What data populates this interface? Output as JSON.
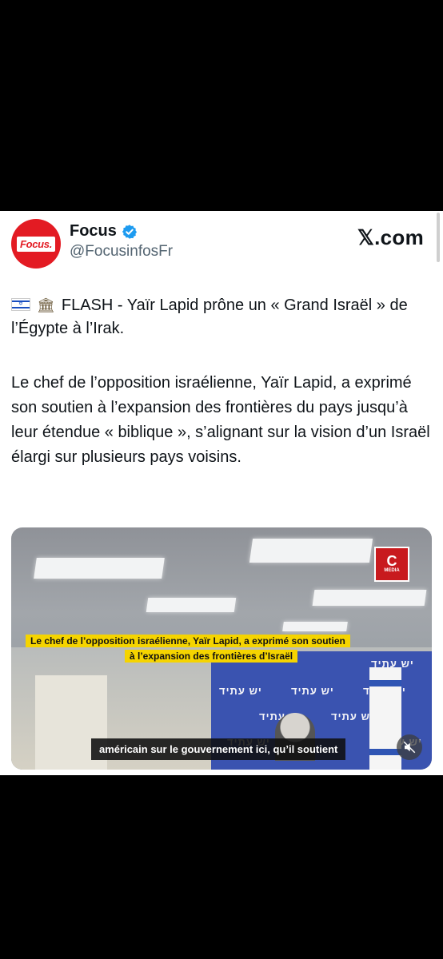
{
  "author": {
    "avatar_text": "Focus.",
    "name": "Focus",
    "handle": "@FocusinfosFr"
  },
  "brand": "𝕏.com",
  "icons": {
    "flag": "israel-flag-icon",
    "building": "classical-building-icon",
    "verified": "verified-badge-icon",
    "mute": "muted-speaker-icon"
  },
  "post": {
    "headline": "FLASH - Yaïr Lapid prône un « Grand Israël » de l’Égypte à l’Irak.",
    "body": "Le chef de l’opposition israélienne, Yaïr Lapid, a exprimé son soutien à l’expansion des frontières du pays jusqu’à leur étendue « biblique », s’alignant sur la vision d’un Israël élargi sur plusieurs pays voisins."
  },
  "media": {
    "watermark_letter": "C",
    "watermark_label": "MEDIA",
    "caption_line1": "Le chef de l’opposition israélienne, Yaïr Lapid, a exprimé son soutien",
    "caption_line2": "à l’expansion des frontières d’Israël",
    "subtitle": "américain sur le gouvernement ici, qu’il soutient",
    "banner_text": "יש עתיד"
  },
  "colors": {
    "accent_red": "#e31b23",
    "verified_blue": "#1d9bf0",
    "caption_yellow": "#f5d400",
    "banner_blue": "#3a53b0"
  }
}
